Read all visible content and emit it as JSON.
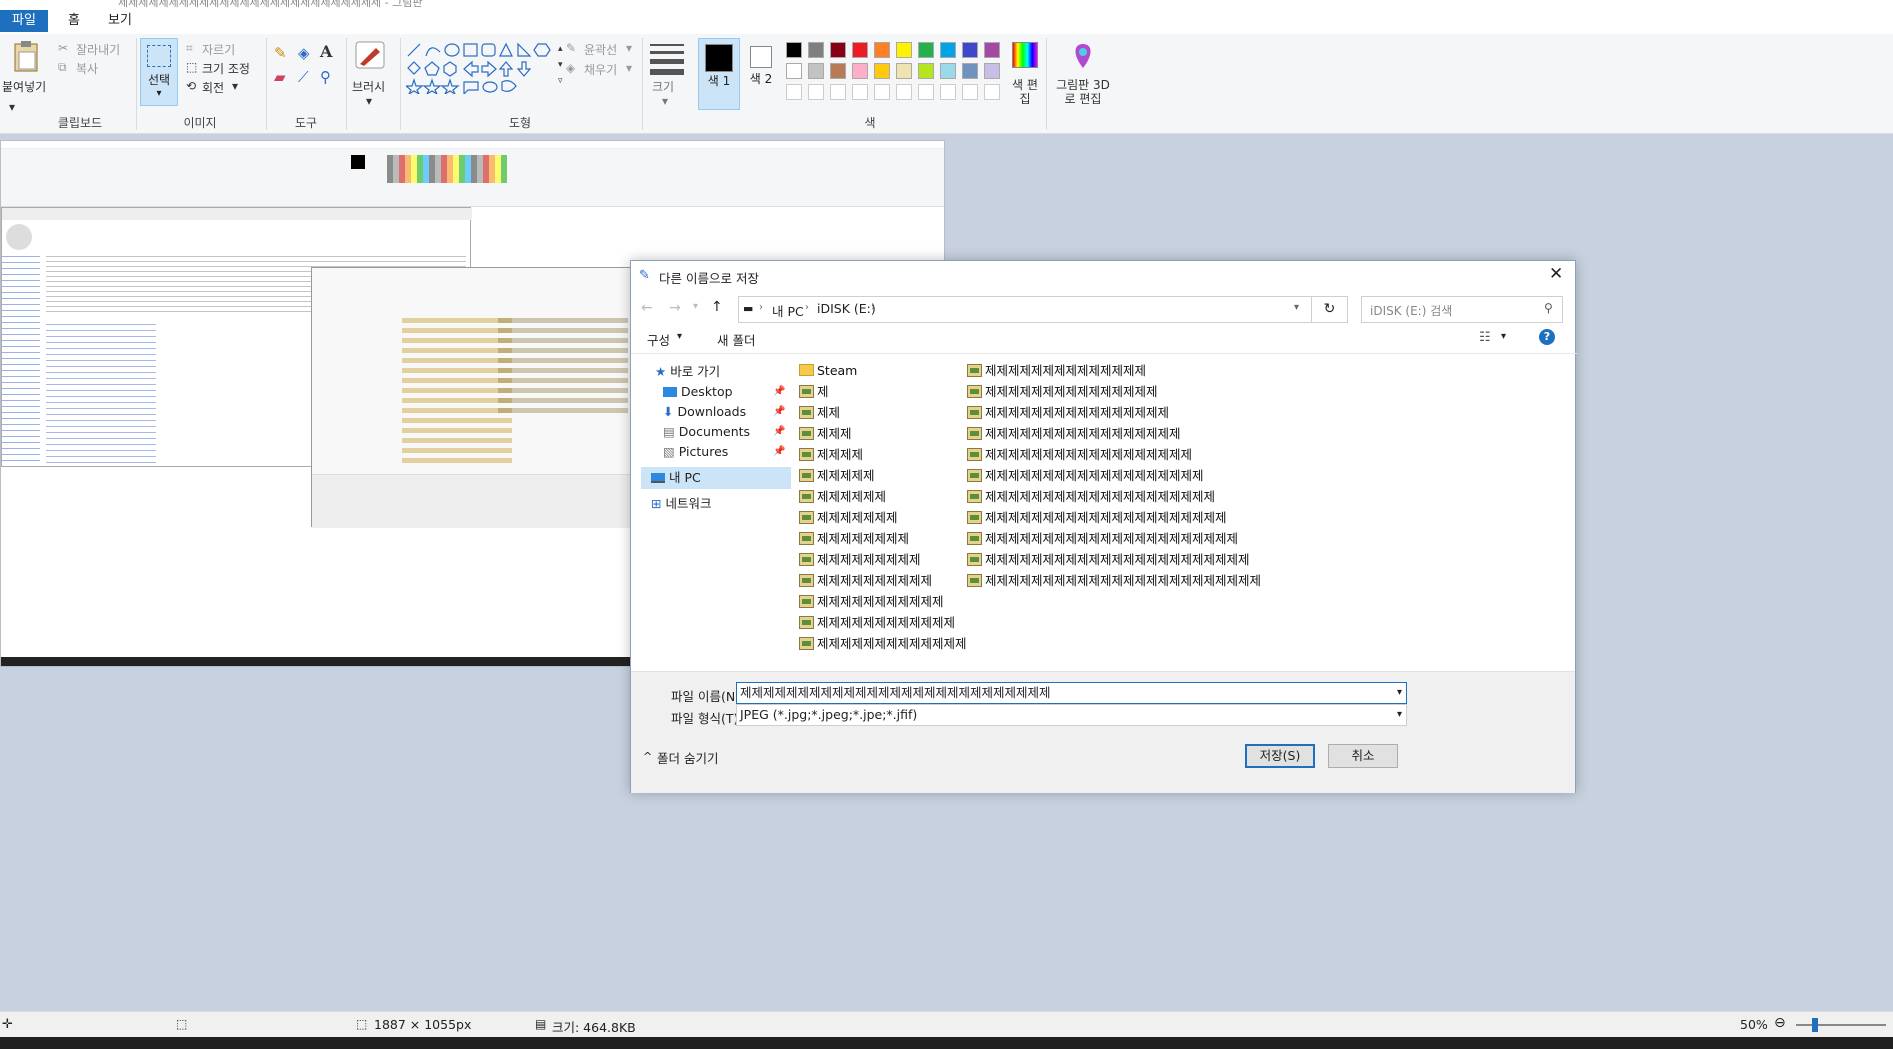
{
  "app": {
    "title_partial": "제제제제제제제제제제제제제제제제제제제제제제제제제제 - 그림판"
  },
  "menu": {
    "tabs": [
      "파일",
      "홈",
      "보기"
    ]
  },
  "ribbon": {
    "clipboard": {
      "paste": "붙여넣기",
      "cut": "잘라내기",
      "copy": "복사",
      "label": "클립보드"
    },
    "image": {
      "select": "선택",
      "crop": "자르기",
      "resize": "크기 조정",
      "rotate": "회전",
      "label": "이미지"
    },
    "tools": {
      "label": "도구"
    },
    "brush": {
      "label": "브러시"
    },
    "shapes": {
      "outline": "윤곽선",
      "fill": "채우기",
      "label": "도형"
    },
    "size": {
      "label": "크기"
    },
    "colors": {
      "color1": "색 1",
      "color2": "색 2",
      "edit": "색 편집",
      "label": "색"
    },
    "paint3d": {
      "label": "그림판 3D로 편집"
    },
    "palette_row1": [
      "#000000",
      "#7f7f7f",
      "#880015",
      "#ed1c24",
      "#ff7f27",
      "#fff200",
      "#22b14c",
      "#00a2e8",
      "#3f48cc",
      "#a349a4"
    ],
    "palette_row2": [
      "#ffffff",
      "#c3c3c3",
      "#b97a57",
      "#ffaec9",
      "#ffc90e",
      "#efe4b0",
      "#b5e61d",
      "#99d9ea",
      "#7092be",
      "#c8bfe7"
    ]
  },
  "dialog": {
    "title": "다른 이름으로 저장",
    "address": {
      "pc": "내 PC",
      "drive": "iDISK (E:)"
    },
    "search_placeholder": "iDISK (E:) 검색",
    "toolbar": {
      "organize": "구성",
      "new_folder": "새 폴더"
    },
    "nav": {
      "quick_access": "바로 가기",
      "items": [
        "Desktop",
        "Downloads",
        "Documents",
        "Pictures"
      ],
      "this_pc": "내 PC",
      "network": "네트워크"
    },
    "files_col1": [
      "Steam",
      "제",
      "제제",
      "제제제",
      "제제제제",
      "제제제제제",
      "제제제제제제",
      "제제제제제제제",
      "제제제제제제제제",
      "제제제제제제제제제",
      "제제제제제제제제제제",
      "제제제제제제제제제제제",
      "제제제제제제제제제제제제",
      "제제제제제제제제제제제제제"
    ],
    "files_col2": [
      "제제제제제제제제제제제제제제",
      "제제제제제제제제제제제제제제제",
      "제제제제제제제제제제제제제제제제",
      "제제제제제제제제제제제제제제제제제",
      "제제제제제제제제제제제제제제제제제제",
      "제제제제제제제제제제제제제제제제제제제",
      "제제제제제제제제제제제제제제제제제제제제",
      "제제제제제제제제제제제제제제제제제제제제제",
      "제제제제제제제제제제제제제제제제제제제제제제",
      "제제제제제제제제제제제제제제제제제제제제제제제",
      "제제제제제제제제제제제제제제제제제제제제제제제제"
    ],
    "filename_label": "파일 이름(N):",
    "filename_value": "제제제제제제제제제제제제제제제제제제제제제제제제제제제",
    "filetype_label": "파일 형식(T):",
    "filetype_value": "JPEG (*.jpg;*.jpeg;*.jpe;*.jfif)",
    "hide_folders": "폴더 숨기기",
    "save": "저장(S)",
    "cancel": "취소"
  },
  "statusbar": {
    "dimensions": "1887 × 1055px",
    "size": "크기: 464.8KB",
    "zoom": "50%"
  }
}
